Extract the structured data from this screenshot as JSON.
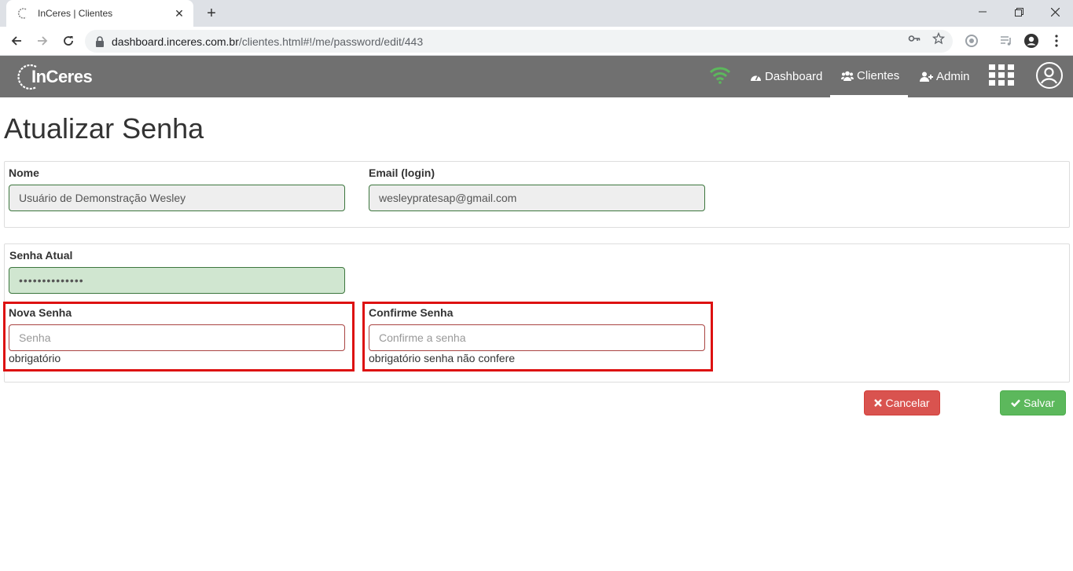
{
  "browser": {
    "tab_title": "InCeres | Clientes",
    "tab_close": "✕",
    "new_tab": "+",
    "url_host": "dashboard.inceres.com.br",
    "url_path": "/clientes.html#!/me/password/edit/443"
  },
  "navbar": {
    "brand": "InCeres",
    "items": [
      {
        "label": "Dashboard",
        "icon": "dashboard-icon"
      },
      {
        "label": "Clientes",
        "icon": "users-icon",
        "active": true
      },
      {
        "label": "Admin",
        "icon": "user-plus-icon"
      }
    ],
    "status_color": "#5cb85c"
  },
  "page": {
    "title": "Atualizar Senha"
  },
  "form": {
    "nome_label": "Nome",
    "nome_value": "Usuário de Demonstração Wesley",
    "email_label": "Email (login)",
    "email_value": "wesleypratesap@gmail.com",
    "senha_atual_label": "Senha Atual",
    "senha_atual_value": "••••••••••••••",
    "nova_senha_label": "Nova Senha",
    "nova_senha_placeholder": "Senha",
    "nova_senha_help": "obrigatório",
    "confirme_label": "Confirme Senha",
    "confirme_placeholder": "Confirme a senha",
    "confirme_help": "obrigatório senha não confere"
  },
  "actions": {
    "cancel_label": "Cancelar",
    "save_label": "Salvar"
  },
  "colors": {
    "navbar_bg": "#707070",
    "danger": "#d9534f",
    "success": "#5cb85c",
    "highlight": "#dd1111"
  }
}
